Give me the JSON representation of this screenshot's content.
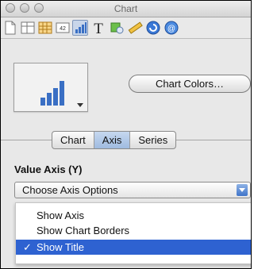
{
  "window": {
    "title": "Chart"
  },
  "toolbar": {
    "icons": [
      "document-icon",
      "table-icon",
      "grid-icon",
      "number-field-icon",
      "chart-icon",
      "text-icon",
      "shapes-icon",
      "ruler-icon",
      "link-icon",
      "help-icon"
    ],
    "selected": "chart-icon"
  },
  "chart_section": {
    "colors_button": "Chart Colors…"
  },
  "tabs": [
    "Chart",
    "Axis",
    "Series"
  ],
  "active_tab": "Axis",
  "axis_panel": {
    "label": "Value Axis (Y)",
    "dropdown_value": "Choose Axis Options",
    "menu_items": [
      {
        "label": "Show Axis",
        "checked": false
      },
      {
        "label": "Show Chart Borders",
        "checked": false
      },
      {
        "label": "Show Title",
        "checked": true
      }
    ],
    "check_mark": "✓"
  }
}
